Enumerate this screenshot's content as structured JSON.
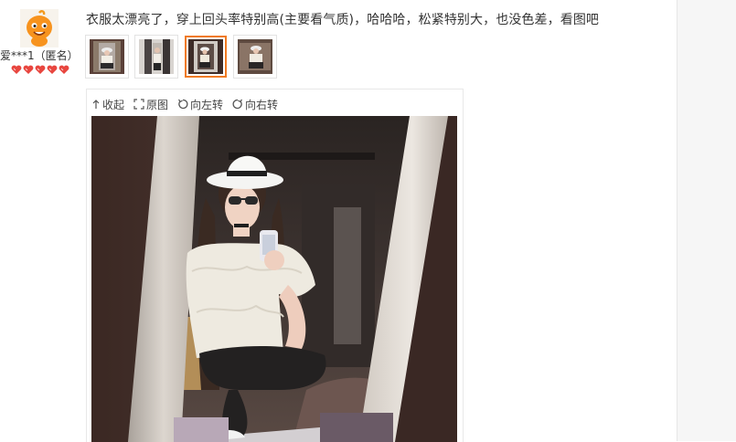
{
  "reviewer": {
    "username": "爱***1（匿名）",
    "rank_hearts": 5,
    "avatar_icon": "orange-mascot-avatar"
  },
  "review": {
    "text": "衣服太漂亮了，穿上回头率特别高(主要看气质)，哈哈哈，松紧特别大，也没色差，看图吧"
  },
  "thumbnails": {
    "count": 4,
    "active_index": 2
  },
  "viewer": {
    "toolbar": {
      "collapse_label": "收起",
      "original_label": "原图",
      "rotate_left_label": "向左转",
      "rotate_right_label": "向右转"
    }
  },
  "colors": {
    "accent": "#f07a22",
    "heart": "#e8463f",
    "text": "#333333"
  }
}
